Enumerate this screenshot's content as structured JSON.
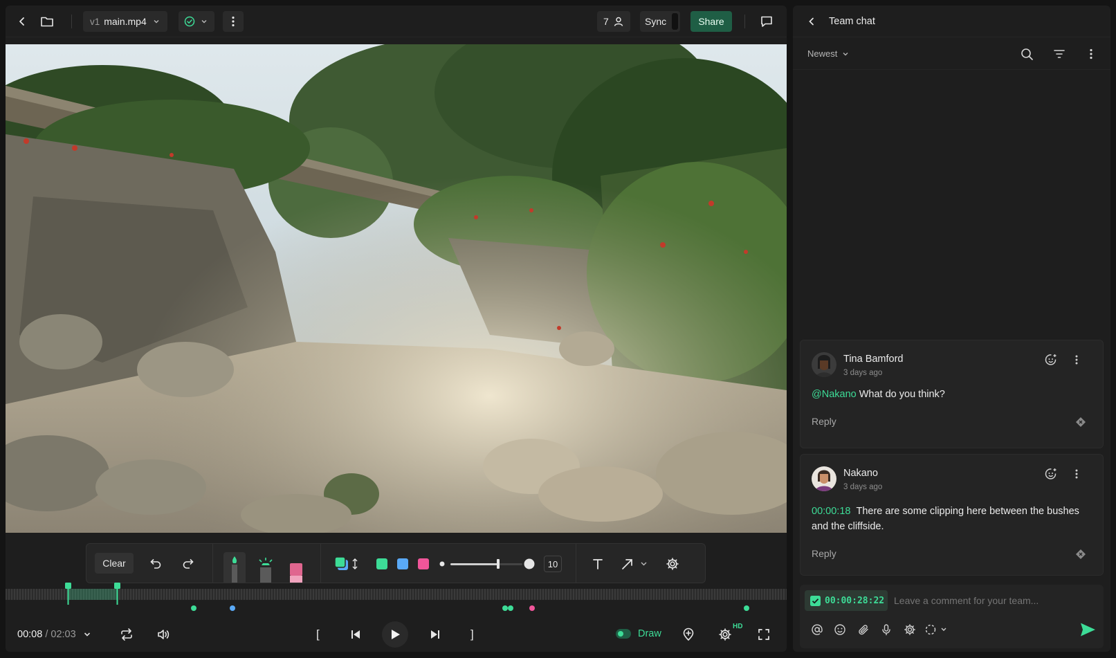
{
  "header": {
    "version_label": "v1",
    "file_name": "main.mp4",
    "viewer_count": "7",
    "sync_label": "Sync",
    "share_label": "Share"
  },
  "toolbar": {
    "clear_label": "Clear",
    "brush_size": "10",
    "colors": [
      "#3ddc97",
      "#5aa9f6",
      "#f0569a"
    ]
  },
  "player": {
    "current_time": "00:08",
    "separator": " / ",
    "duration": "02:03",
    "mark_in": "[",
    "mark_out": "]",
    "draw_label": "Draw",
    "quality_badge": "HD",
    "draw_enabled": true
  },
  "chat": {
    "title": "Team chat",
    "sort_label": "Newest",
    "comments": [
      {
        "author": "Tina Bamford",
        "time": "3 days ago",
        "mention": "@Nakano",
        "text": "What do you think?",
        "reply_label": "Reply"
      },
      {
        "author": "Nakano",
        "time": "3 days ago",
        "timestamp": "00:00:18",
        "text": "There are some clipping here between the bushes and the cliffside.",
        "reply_label": "Reply"
      }
    ],
    "composer": {
      "timecode": "00:00:28:22",
      "placeholder": "Leave a comment for your team..."
    }
  },
  "colors": {
    "accent": "#3ddc97",
    "share_bg": "#1f5e45",
    "panel_bg": "#1e1e1e",
    "app_bg": "#141414"
  }
}
